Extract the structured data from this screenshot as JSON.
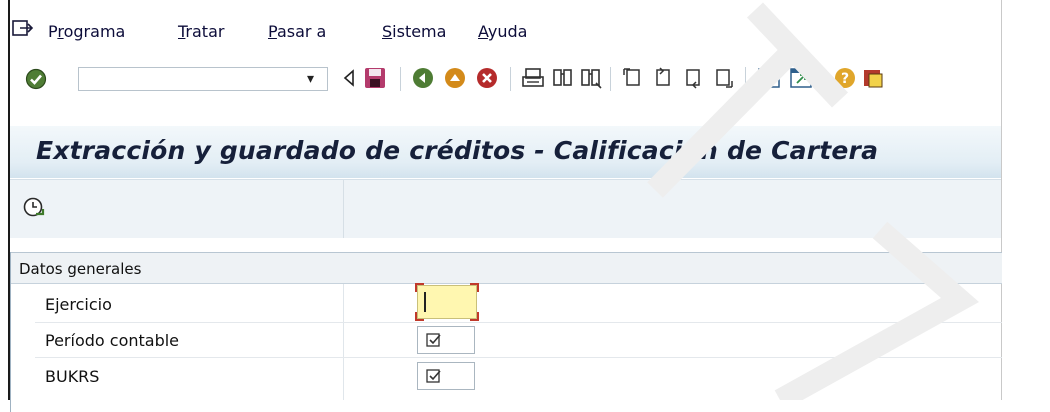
{
  "menu": {
    "items": [
      {
        "before": "P",
        "underline": "r",
        "after": "ograma"
      },
      {
        "before": "",
        "underline": "T",
        "after": "ratar"
      },
      {
        "before": "",
        "underline": "P",
        "after": "asar a"
      },
      {
        "before": "",
        "underline": "S",
        "after": "istema"
      },
      {
        "before": "",
        "underline": "A",
        "after": "yuda"
      }
    ]
  },
  "toolbar": {
    "command_field_value": "",
    "dropdown_glyph": "▾"
  },
  "title": "Extracción y guardado de créditos - Calificación de Cartera",
  "group": {
    "title": "Datos generales",
    "fields": [
      {
        "label": "Ejercicio",
        "value": ""
      },
      {
        "label": "Período contable",
        "checked": true
      },
      {
        "label": "BUKRS",
        "checked": true
      }
    ]
  },
  "colors": {
    "input_required": "#fff7b0",
    "title_text": "#16203a",
    "accent_red": "#c0392b"
  }
}
